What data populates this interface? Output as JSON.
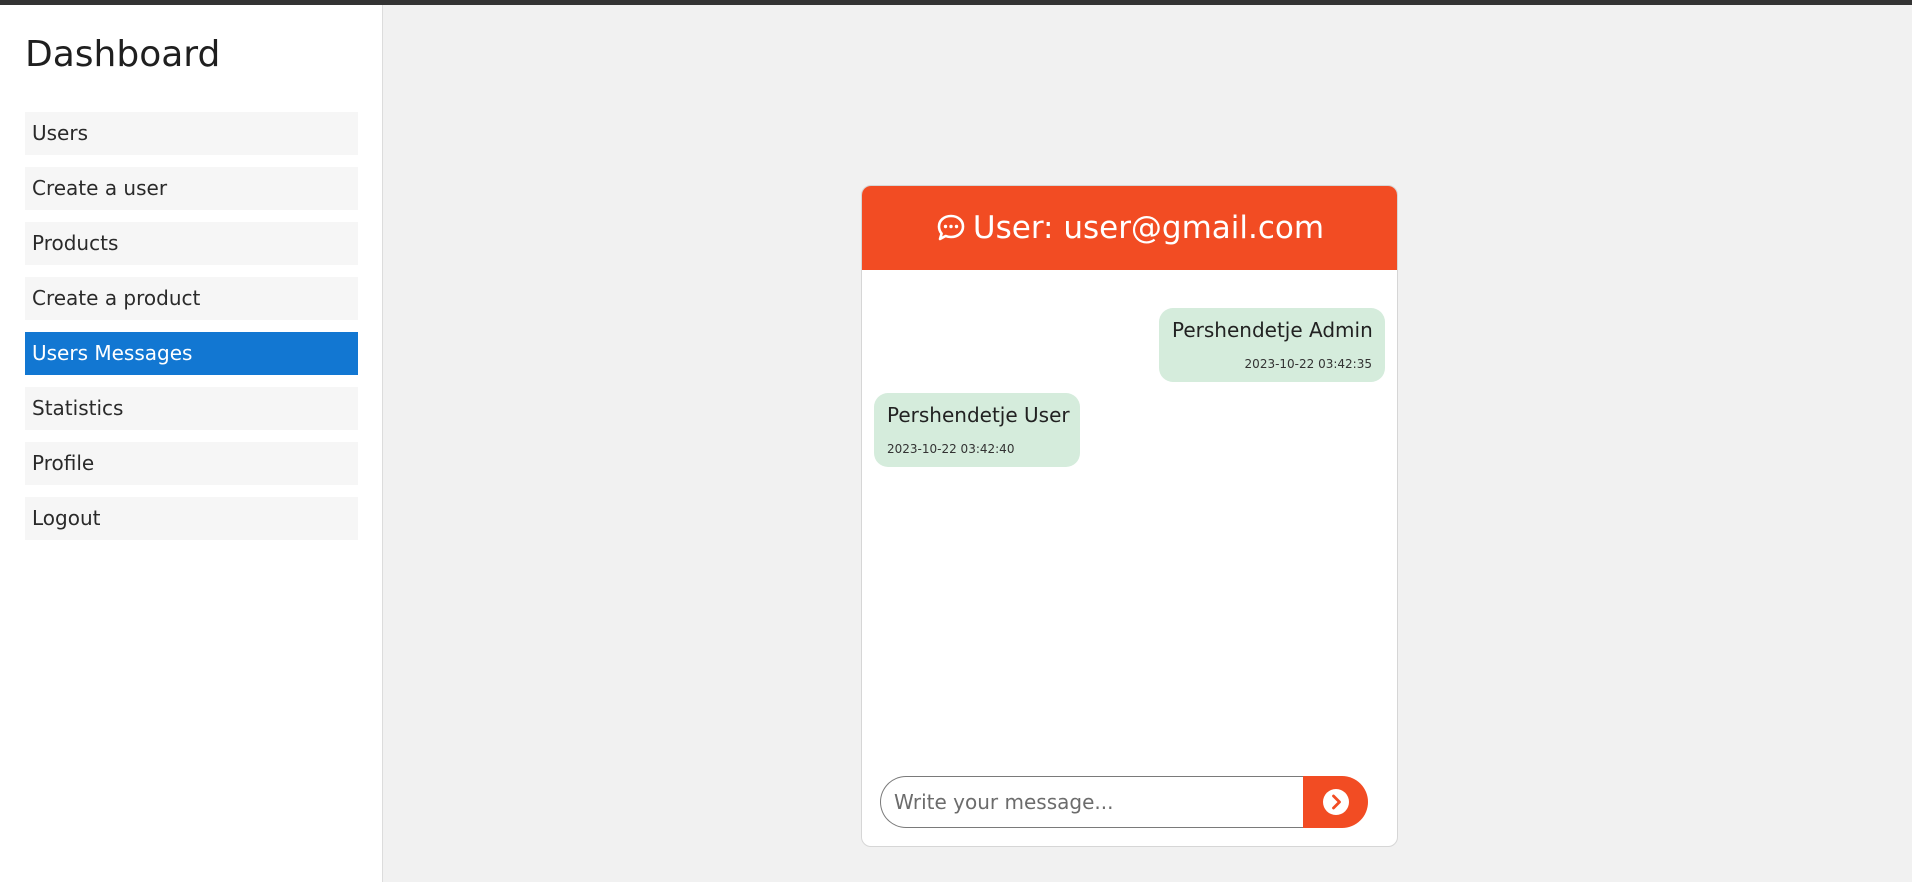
{
  "sidebar": {
    "title": "Dashboard",
    "items": [
      {
        "label": "Users",
        "active": false
      },
      {
        "label": "Create a user",
        "active": false
      },
      {
        "label": "Products",
        "active": false
      },
      {
        "label": "Create a product",
        "active": false
      },
      {
        "label": "Users Messages",
        "active": true
      },
      {
        "label": "Statistics",
        "active": false
      },
      {
        "label": "Profile",
        "active": false
      },
      {
        "label": "Logout",
        "active": false
      }
    ]
  },
  "chat": {
    "header_title": "User: user@gmail.com",
    "header_icon": "chat-bubble-icon",
    "messages": [
      {
        "text": "Pershendetje Admin",
        "time": "2023-10-22 03:42:35",
        "side": "right"
      },
      {
        "text": "Pershendetje User",
        "time": "2023-10-22 03:42:40",
        "side": "left"
      }
    ],
    "input": {
      "placeholder": "Write your message...",
      "value": ""
    },
    "send_icon": "chevron-right-circle-icon"
  },
  "colors": {
    "accent": "#f24c23",
    "nav_active": "#1277d2",
    "bubble": "#d5ecdc",
    "topbar": "#333333"
  }
}
